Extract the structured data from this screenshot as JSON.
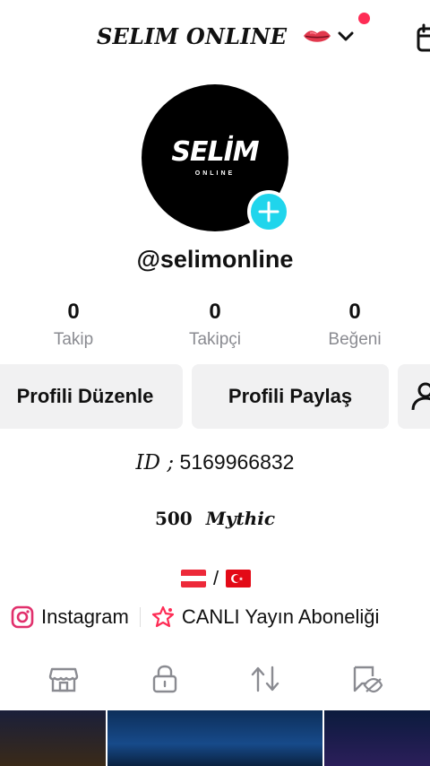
{
  "header": {
    "account_name": "SELIM ONLINE",
    "lips_icon": "lips-emoji-icon",
    "switch_icon": "chevron-down-icon",
    "calendar_icon": "calendar-add-icon",
    "notification_color": "#fe2c55"
  },
  "profile": {
    "avatar_text": "SELİM",
    "avatar_subtext": "ONLINE",
    "handle": "@selimonline",
    "add_icon": "plus-icon",
    "add_color": "#20d5ec"
  },
  "stats": [
    {
      "value": "0",
      "label": "Takip"
    },
    {
      "value": "0",
      "label": "Takipçi"
    },
    {
      "value": "0",
      "label": "Beğeni"
    }
  ],
  "actions": {
    "edit_profile": "Profili Düzenle",
    "share_profile": "Profili Paylaş",
    "add_friend_icon": "add-friend-icon"
  },
  "bio": {
    "id_label": "ID ;",
    "id_value": "5169966832",
    "mythic_number": "500",
    "mythic_word": "Mythic",
    "flag_left": "austria-flag-icon",
    "flag_separator": "/",
    "flag_right": "turkey-flag-icon"
  },
  "links": [
    {
      "label": "Instagram",
      "icon": "instagram-icon"
    },
    {
      "label": "CANLI Yayın Aboneliği",
      "icon": "live-subscription-icon"
    }
  ],
  "tabs": [
    {
      "icon": "shop-icon"
    },
    {
      "icon": "lock-icon"
    },
    {
      "icon": "repost-icon"
    },
    {
      "icon": "liked-hidden-icon"
    }
  ],
  "colors": {
    "accent": "#fe2c55",
    "muted_text": "#8a8b91",
    "button_bg": "#f1f1f2"
  }
}
